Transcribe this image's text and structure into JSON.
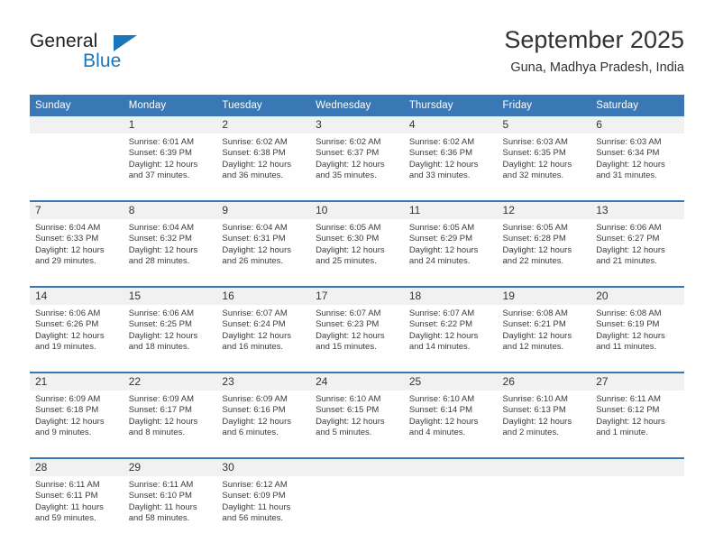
{
  "brand": {
    "name_part1": "General",
    "name_part2": "Blue",
    "accent_color": "#1b75bb"
  },
  "header": {
    "title": "September 2025",
    "subtitle": "Guna, Madhya Pradesh, India"
  },
  "theme": {
    "header_blue": "#3a78b5",
    "number_band": "#f1f1f1"
  },
  "weekdays": [
    "Sunday",
    "Monday",
    "Tuesday",
    "Wednesday",
    "Thursday",
    "Friday",
    "Saturday"
  ],
  "weeks": [
    [
      {
        "day": "",
        "sunrise": "",
        "sunset": "",
        "daylight_line1": "",
        "daylight_line2": ""
      },
      {
        "day": "1",
        "sunrise": "Sunrise: 6:01 AM",
        "sunset": "Sunset: 6:39 PM",
        "daylight_line1": "Daylight: 12 hours",
        "daylight_line2": "and 37 minutes."
      },
      {
        "day": "2",
        "sunrise": "Sunrise: 6:02 AM",
        "sunset": "Sunset: 6:38 PM",
        "daylight_line1": "Daylight: 12 hours",
        "daylight_line2": "and 36 minutes."
      },
      {
        "day": "3",
        "sunrise": "Sunrise: 6:02 AM",
        "sunset": "Sunset: 6:37 PM",
        "daylight_line1": "Daylight: 12 hours",
        "daylight_line2": "and 35 minutes."
      },
      {
        "day": "4",
        "sunrise": "Sunrise: 6:02 AM",
        "sunset": "Sunset: 6:36 PM",
        "daylight_line1": "Daylight: 12 hours",
        "daylight_line2": "and 33 minutes."
      },
      {
        "day": "5",
        "sunrise": "Sunrise: 6:03 AM",
        "sunset": "Sunset: 6:35 PM",
        "daylight_line1": "Daylight: 12 hours",
        "daylight_line2": "and 32 minutes."
      },
      {
        "day": "6",
        "sunrise": "Sunrise: 6:03 AM",
        "sunset": "Sunset: 6:34 PM",
        "daylight_line1": "Daylight: 12 hours",
        "daylight_line2": "and 31 minutes."
      }
    ],
    [
      {
        "day": "7",
        "sunrise": "Sunrise: 6:04 AM",
        "sunset": "Sunset: 6:33 PM",
        "daylight_line1": "Daylight: 12 hours",
        "daylight_line2": "and 29 minutes."
      },
      {
        "day": "8",
        "sunrise": "Sunrise: 6:04 AM",
        "sunset": "Sunset: 6:32 PM",
        "daylight_line1": "Daylight: 12 hours",
        "daylight_line2": "and 28 minutes."
      },
      {
        "day": "9",
        "sunrise": "Sunrise: 6:04 AM",
        "sunset": "Sunset: 6:31 PM",
        "daylight_line1": "Daylight: 12 hours",
        "daylight_line2": "and 26 minutes."
      },
      {
        "day": "10",
        "sunrise": "Sunrise: 6:05 AM",
        "sunset": "Sunset: 6:30 PM",
        "daylight_line1": "Daylight: 12 hours",
        "daylight_line2": "and 25 minutes."
      },
      {
        "day": "11",
        "sunrise": "Sunrise: 6:05 AM",
        "sunset": "Sunset: 6:29 PM",
        "daylight_line1": "Daylight: 12 hours",
        "daylight_line2": "and 24 minutes."
      },
      {
        "day": "12",
        "sunrise": "Sunrise: 6:05 AM",
        "sunset": "Sunset: 6:28 PM",
        "daylight_line1": "Daylight: 12 hours",
        "daylight_line2": "and 22 minutes."
      },
      {
        "day": "13",
        "sunrise": "Sunrise: 6:06 AM",
        "sunset": "Sunset: 6:27 PM",
        "daylight_line1": "Daylight: 12 hours",
        "daylight_line2": "and 21 minutes."
      }
    ],
    [
      {
        "day": "14",
        "sunrise": "Sunrise: 6:06 AM",
        "sunset": "Sunset: 6:26 PM",
        "daylight_line1": "Daylight: 12 hours",
        "daylight_line2": "and 19 minutes."
      },
      {
        "day": "15",
        "sunrise": "Sunrise: 6:06 AM",
        "sunset": "Sunset: 6:25 PM",
        "daylight_line1": "Daylight: 12 hours",
        "daylight_line2": "and 18 minutes."
      },
      {
        "day": "16",
        "sunrise": "Sunrise: 6:07 AM",
        "sunset": "Sunset: 6:24 PM",
        "daylight_line1": "Daylight: 12 hours",
        "daylight_line2": "and 16 minutes."
      },
      {
        "day": "17",
        "sunrise": "Sunrise: 6:07 AM",
        "sunset": "Sunset: 6:23 PM",
        "daylight_line1": "Daylight: 12 hours",
        "daylight_line2": "and 15 minutes."
      },
      {
        "day": "18",
        "sunrise": "Sunrise: 6:07 AM",
        "sunset": "Sunset: 6:22 PM",
        "daylight_line1": "Daylight: 12 hours",
        "daylight_line2": "and 14 minutes."
      },
      {
        "day": "19",
        "sunrise": "Sunrise: 6:08 AM",
        "sunset": "Sunset: 6:21 PM",
        "daylight_line1": "Daylight: 12 hours",
        "daylight_line2": "and 12 minutes."
      },
      {
        "day": "20",
        "sunrise": "Sunrise: 6:08 AM",
        "sunset": "Sunset: 6:19 PM",
        "daylight_line1": "Daylight: 12 hours",
        "daylight_line2": "and 11 minutes."
      }
    ],
    [
      {
        "day": "21",
        "sunrise": "Sunrise: 6:09 AM",
        "sunset": "Sunset: 6:18 PM",
        "daylight_line1": "Daylight: 12 hours",
        "daylight_line2": "and 9 minutes."
      },
      {
        "day": "22",
        "sunrise": "Sunrise: 6:09 AM",
        "sunset": "Sunset: 6:17 PM",
        "daylight_line1": "Daylight: 12 hours",
        "daylight_line2": "and 8 minutes."
      },
      {
        "day": "23",
        "sunrise": "Sunrise: 6:09 AM",
        "sunset": "Sunset: 6:16 PM",
        "daylight_line1": "Daylight: 12 hours",
        "daylight_line2": "and 6 minutes."
      },
      {
        "day": "24",
        "sunrise": "Sunrise: 6:10 AM",
        "sunset": "Sunset: 6:15 PM",
        "daylight_line1": "Daylight: 12 hours",
        "daylight_line2": "and 5 minutes."
      },
      {
        "day": "25",
        "sunrise": "Sunrise: 6:10 AM",
        "sunset": "Sunset: 6:14 PM",
        "daylight_line1": "Daylight: 12 hours",
        "daylight_line2": "and 4 minutes."
      },
      {
        "day": "26",
        "sunrise": "Sunrise: 6:10 AM",
        "sunset": "Sunset: 6:13 PM",
        "daylight_line1": "Daylight: 12 hours",
        "daylight_line2": "and 2 minutes."
      },
      {
        "day": "27",
        "sunrise": "Sunrise: 6:11 AM",
        "sunset": "Sunset: 6:12 PM",
        "daylight_line1": "Daylight: 12 hours",
        "daylight_line2": "and 1 minute."
      }
    ],
    [
      {
        "day": "28",
        "sunrise": "Sunrise: 6:11 AM",
        "sunset": "Sunset: 6:11 PM",
        "daylight_line1": "Daylight: 11 hours",
        "daylight_line2": "and 59 minutes."
      },
      {
        "day": "29",
        "sunrise": "Sunrise: 6:11 AM",
        "sunset": "Sunset: 6:10 PM",
        "daylight_line1": "Daylight: 11 hours",
        "daylight_line2": "and 58 minutes."
      },
      {
        "day": "30",
        "sunrise": "Sunrise: 6:12 AM",
        "sunset": "Sunset: 6:09 PM",
        "daylight_line1": "Daylight: 11 hours",
        "daylight_line2": "and 56 minutes."
      },
      {
        "day": "",
        "sunrise": "",
        "sunset": "",
        "daylight_line1": "",
        "daylight_line2": ""
      },
      {
        "day": "",
        "sunrise": "",
        "sunset": "",
        "daylight_line1": "",
        "daylight_line2": ""
      },
      {
        "day": "",
        "sunrise": "",
        "sunset": "",
        "daylight_line1": "",
        "daylight_line2": ""
      },
      {
        "day": "",
        "sunrise": "",
        "sunset": "",
        "daylight_line1": "",
        "daylight_line2": ""
      }
    ]
  ]
}
